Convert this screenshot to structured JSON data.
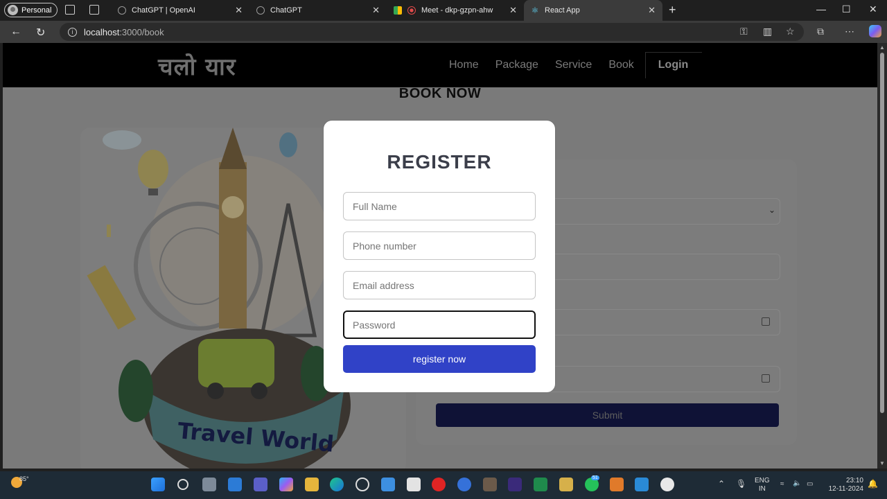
{
  "browser": {
    "profile": "Personal",
    "tabs": [
      {
        "title": "ChatGPT | OpenAI"
      },
      {
        "title": "ChatGPT"
      },
      {
        "title": "Meet - dkp-gzpn-ahw"
      },
      {
        "title": "React App"
      }
    ],
    "url_host": "localhost",
    "url_path": ":3000/book"
  },
  "site": {
    "logo": "चलो यार",
    "nav": [
      "Home",
      "Package",
      "Service",
      "Book"
    ],
    "login": "Login",
    "page_title": "BOOK NOW",
    "illustration_text": "Travel World",
    "submit": "Submit"
  },
  "modal": {
    "title": "REGISTER",
    "fields": [
      {
        "placeholder": "Full Name"
      },
      {
        "placeholder": "Phone number"
      },
      {
        "placeholder": "Email address"
      },
      {
        "placeholder": "Password"
      }
    ],
    "button": "register now"
  },
  "taskbar": {
    "temperature": "85°",
    "lang_line1": "ENG",
    "lang_line2": "IN",
    "time": "23:10",
    "date": "12-11-2024",
    "whatsapp_badge": "51"
  },
  "colors": {
    "primary_button": "#3042c7",
    "submit_button": "#0f1236"
  }
}
